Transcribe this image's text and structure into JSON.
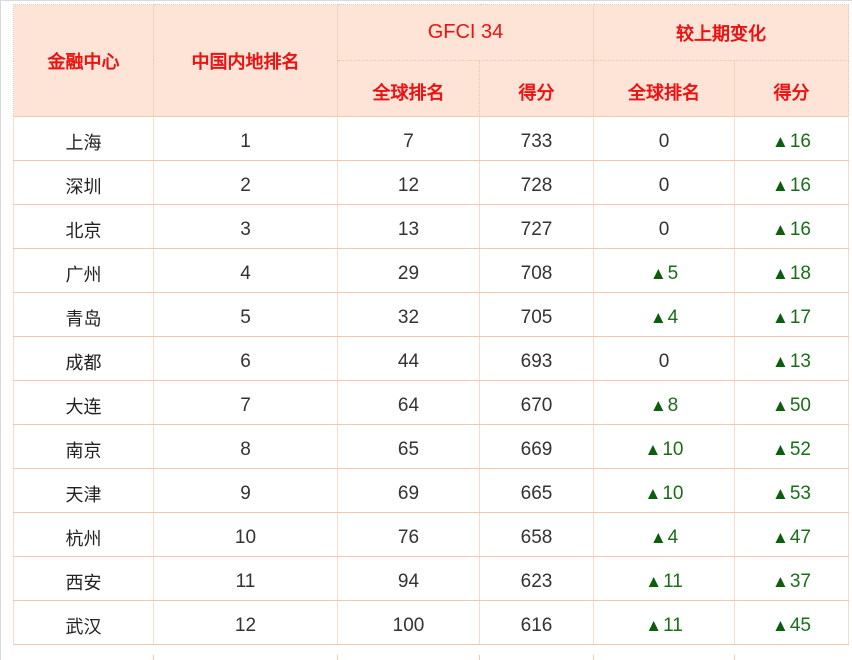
{
  "header": {
    "city": "金融中心",
    "mainland_rank": "中国内地排名",
    "gfci": "GFCI 34",
    "change": "较上期变化",
    "global_rank": "全球排名",
    "score": "得分",
    "change_global_rank": "全球排名",
    "change_score": "得分"
  },
  "colors": {
    "header_bg": "#fde4d7",
    "header_text": "#ee1111",
    "up_arrow": "#0c5e0c"
  },
  "rows": [
    {
      "city": "上海",
      "rank": "1",
      "global_rank": "7",
      "score": "733",
      "rank_change": "0",
      "rank_up": false,
      "score_change": "16",
      "score_up": true
    },
    {
      "city": "深圳",
      "rank": "2",
      "global_rank": "12",
      "score": "728",
      "rank_change": "0",
      "rank_up": false,
      "score_change": "16",
      "score_up": true
    },
    {
      "city": "北京",
      "rank": "3",
      "global_rank": "13",
      "score": "727",
      "rank_change": "0",
      "rank_up": false,
      "score_change": "16",
      "score_up": true
    },
    {
      "city": "广州",
      "rank": "4",
      "global_rank": "29",
      "score": "708",
      "rank_change": "5",
      "rank_up": true,
      "score_change": "18",
      "score_up": true
    },
    {
      "city": "青岛",
      "rank": "5",
      "global_rank": "32",
      "score": "705",
      "rank_change": "4",
      "rank_up": true,
      "score_change": "17",
      "score_up": true
    },
    {
      "city": "成都",
      "rank": "6",
      "global_rank": "44",
      "score": "693",
      "rank_change": "0",
      "rank_up": false,
      "score_change": "13",
      "score_up": true
    },
    {
      "city": "大连",
      "rank": "7",
      "global_rank": "64",
      "score": "670",
      "rank_change": "8",
      "rank_up": true,
      "score_change": "50",
      "score_up": true
    },
    {
      "city": "南京",
      "rank": "8",
      "global_rank": "65",
      "score": "669",
      "rank_change": "10",
      "rank_up": true,
      "score_change": "52",
      "score_up": true
    },
    {
      "city": "天津",
      "rank": "9",
      "global_rank": "69",
      "score": "665",
      "rank_change": "10",
      "rank_up": true,
      "score_change": "53",
      "score_up": true
    },
    {
      "city": "杭州",
      "rank": "10",
      "global_rank": "76",
      "score": "658",
      "rank_change": "4",
      "rank_up": true,
      "score_change": "47",
      "score_up": true
    },
    {
      "city": "西安",
      "rank": "11",
      "global_rank": "94",
      "score": "623",
      "rank_change": "11",
      "rank_up": true,
      "score_change": "37",
      "score_up": true
    },
    {
      "city": "武汉",
      "rank": "12",
      "global_rank": "100",
      "score": "616",
      "rank_change": "11",
      "rank_up": true,
      "score_change": "45",
      "score_up": true
    }
  ]
}
